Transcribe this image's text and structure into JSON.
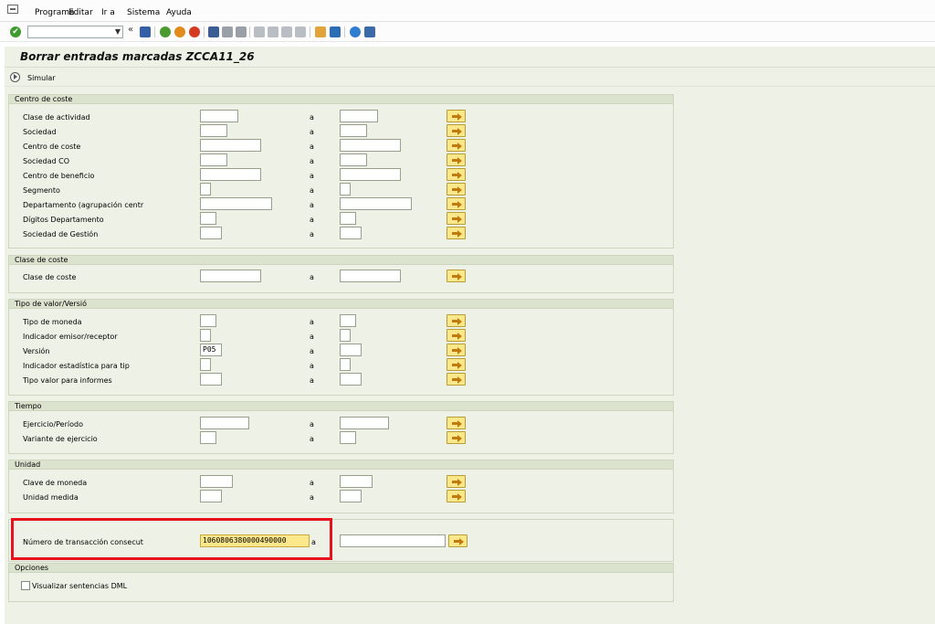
{
  "menubar": {
    "items": [
      "Programa",
      "Editar",
      "Ir a",
      "Sistema",
      "Ayuda"
    ]
  },
  "toolbar": {
    "command_field_value": "",
    "icons": [
      "enter-icon",
      "command-dropdown-icon",
      "back-double-arrow-icon",
      "save-icon",
      "back-icon",
      "exit-icon",
      "cancel-icon",
      "print-icon",
      "find-icon",
      "find-next-icon",
      "first-page-icon",
      "previous-page-icon",
      "next-page-icon",
      "last-page-icon",
      "create-session-icon",
      "shortcut-icon",
      "help-icon",
      "customize-layout-icon"
    ]
  },
  "title": "Borrar entradas marcadas ZCCA11_26",
  "app_toolbar": {
    "simulate_label": "Simular"
  },
  "to_label": "a",
  "groups": {
    "centro_coste": {
      "title": "Centro de coste",
      "rows": [
        {
          "label": "Clase de actividad",
          "from": "",
          "to": ""
        },
        {
          "label": "Sociedad",
          "from": "",
          "to": ""
        },
        {
          "label": "Centro de coste",
          "from": "",
          "to": ""
        },
        {
          "label": "Sociedad CO",
          "from": "",
          "to": ""
        },
        {
          "label": "Centro de beneficio",
          "from": "",
          "to": ""
        },
        {
          "label": "Segmento",
          "from": "",
          "to": ""
        },
        {
          "label": "Departamento (agrupación centr",
          "from": "",
          "to": ""
        },
        {
          "label": "Dígitos Departamento",
          "from": "",
          "to": ""
        },
        {
          "label": "Sociedad de Gestión",
          "from": "",
          "to": ""
        }
      ]
    },
    "clase_coste": {
      "title": "Clase de coste",
      "rows": [
        {
          "label": "Clase de coste",
          "from": "",
          "to": ""
        }
      ]
    },
    "tipo_valor": {
      "title": "Tipo de valor/Versió",
      "rows": [
        {
          "label": "Tipo de moneda",
          "from": "",
          "to": ""
        },
        {
          "label": "Indicador emisor/receptor",
          "from": "",
          "to": ""
        },
        {
          "label": "Versión",
          "from": "P05",
          "to": ""
        },
        {
          "label": "Indicador estadística para tip",
          "from": "",
          "to": ""
        },
        {
          "label": "Tipo valor para informes",
          "from": "",
          "to": ""
        }
      ]
    },
    "tiempo": {
      "title": "Tiempo",
      "rows": [
        {
          "label": "Ejercicio/Período",
          "from": "",
          "to": ""
        },
        {
          "label": "Variante de ejercicio",
          "from": "",
          "to": ""
        }
      ]
    },
    "unidad": {
      "title": "Unidad",
      "rows": [
        {
          "label": "Clave de moneda",
          "from": "",
          "to": ""
        },
        {
          "label": "Unidad medida",
          "from": "",
          "to": ""
        }
      ]
    },
    "transaccion": {
      "rows": [
        {
          "label": "Número de transacción consecut",
          "from": "1060806380000490000",
          "to": ""
        }
      ]
    },
    "opciones": {
      "title": "Opciones",
      "checkbox_label": "Visualizar sentencias DML",
      "checkbox_checked": false
    }
  },
  "colors": {
    "screen_bg": "#eef2e6",
    "group_header_bg": "#dbe3cf",
    "multi_select_btn": "#fce88a",
    "highlight_border": "#e8121f"
  }
}
